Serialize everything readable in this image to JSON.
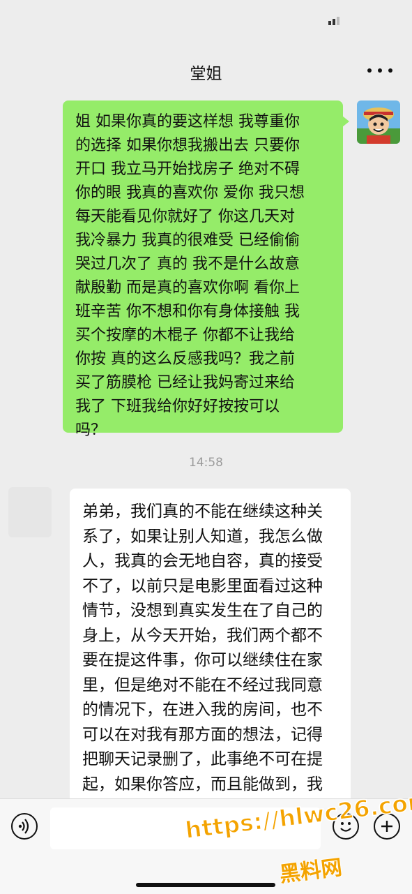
{
  "header": {
    "title": "堂姐"
  },
  "messages": {
    "outgoing_text": "姐 如果你真的要这样想 我尊重你\n的选择 如果你想我搬出去 只要你\n开口 我立马开始找房子 绝对不碍\n你的眼 我真的喜欢你 爱你 我只想\n每天能看见你就好了 你这几天对\n我冷暴力 我真的很难受 已经偷偷\n哭过几次了 真的 我不是什么故意\n献殷勤 而是真的喜欢你啊 看你上\n班辛苦 你不想和你有身体接触 我\n买个按摩的木棍子 你都不让我给\n你按 真的这么反感我吗？我之前\n买了筋膜枪 已经让我妈寄过来给\n我了 下班我给你好好按按可以\n吗？",
    "timestamp": "14:58",
    "incoming_text": "弟弟，我们真的不能在继续这种关\n系了，如果让别人知道，我怎么做\n人，我真的会无地自容，真的接受\n不了，以前只是电影里面看过这种\n情节，没想到真实发生在了自己的\n身上，从今天开始，我们两个都不\n要在提这件事，你可以继续住在家\n里，但是绝对不能在不经过我同意\n的情况下，在进入我的房间，也不\n可以在对我有那方面的想法，记得\n把聊天记录删了，此事绝不可在提\n起，如果你答应，而且能做到，我\n就原谅你，我们就恢复到之前的状\n态，我也不在计较你"
  },
  "icons": {
    "more": "more-icon",
    "voice": "voice-icon",
    "emoji": "emoji-icon",
    "plus": "plus-icon"
  },
  "watermark": {
    "url": "https://hlwc26.com",
    "name": "黑料网"
  },
  "colors": {
    "background": "#ededed",
    "outgoing_bubble": "#95ec69",
    "incoming_bubble": "#ffffff",
    "watermark": "#f4a300"
  }
}
